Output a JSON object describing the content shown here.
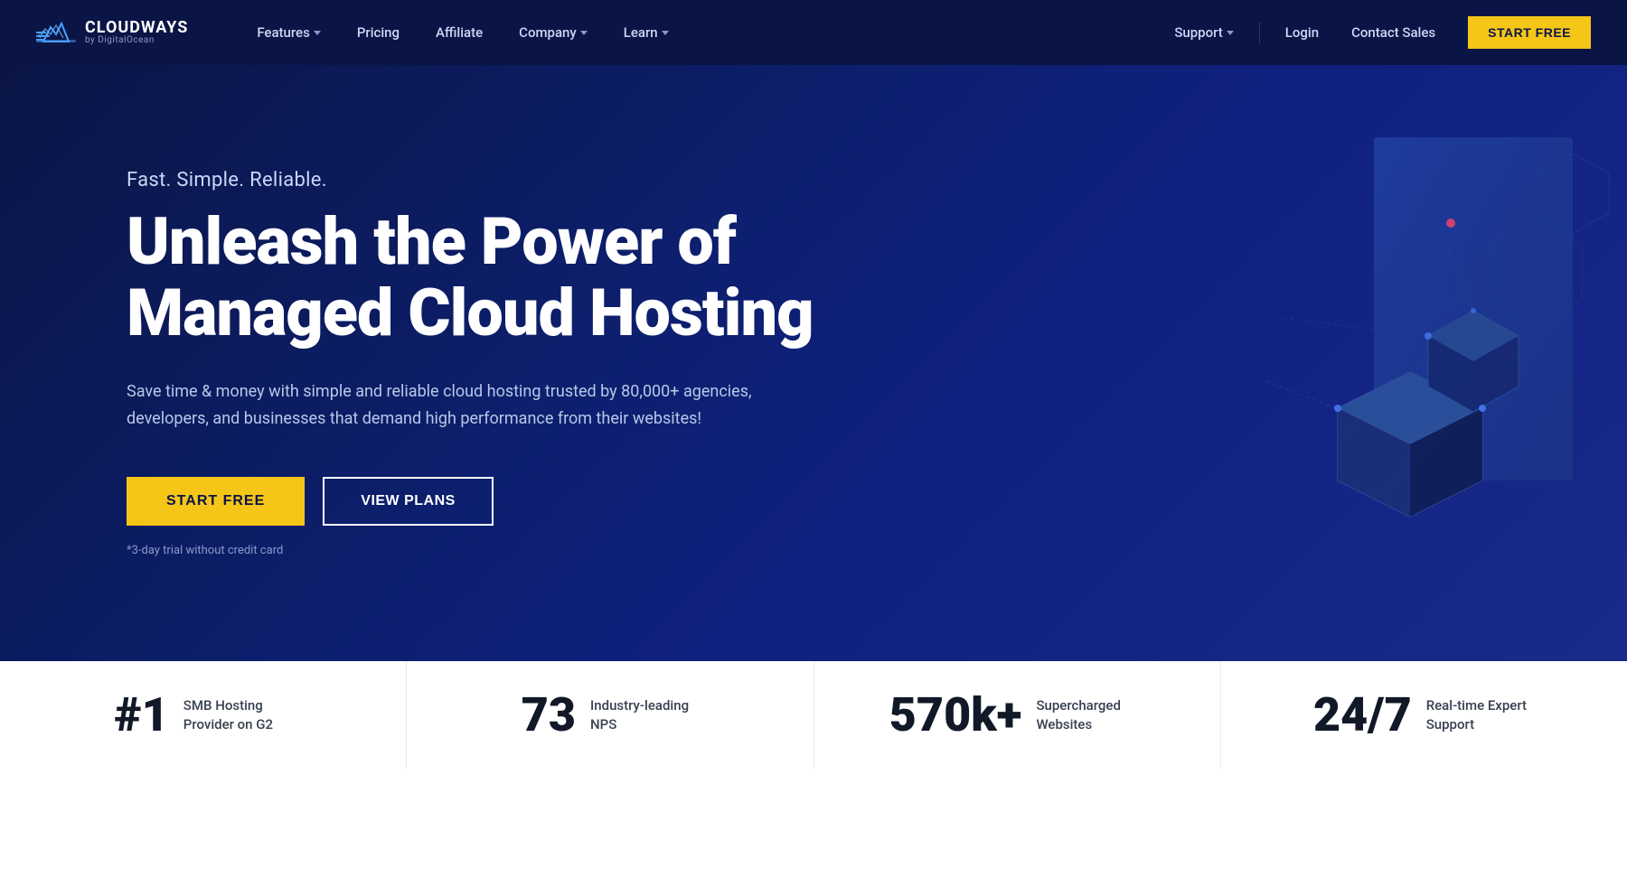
{
  "brand": {
    "name": "CLOUDWAYS",
    "sub": "by DigitalOcean",
    "logo_aria": "Cloudways logo"
  },
  "nav": {
    "links": [
      {
        "label": "Features",
        "has_dropdown": true
      },
      {
        "label": "Pricing",
        "has_dropdown": false
      },
      {
        "label": "Affiliate",
        "has_dropdown": false
      },
      {
        "label": "Company",
        "has_dropdown": true
      },
      {
        "label": "Learn",
        "has_dropdown": true
      }
    ],
    "right_links": [
      {
        "label": "Support",
        "has_dropdown": true
      },
      {
        "label": "Login",
        "has_dropdown": false
      },
      {
        "label": "Contact Sales",
        "has_dropdown": false
      }
    ],
    "cta_label": "START FREE"
  },
  "hero": {
    "tagline": "Fast. Simple. Reliable.",
    "title_line1": "Unleash the Power of",
    "title_line2": "Managed Cloud Hosting",
    "description": "Save time & money with simple and reliable cloud hosting trusted by 80,000+ agencies, developers, and businesses that demand high performance from their websites!",
    "cta_primary": "START FREE",
    "cta_secondary": "VIEW PLANS",
    "note": "*3-day trial without credit card"
  },
  "stats": [
    {
      "number": "#1",
      "description": "SMB Hosting Provider on G2"
    },
    {
      "number": "73",
      "description": "Industry-leading NPS"
    },
    {
      "number": "570k+",
      "description": "Supercharged Websites"
    },
    {
      "number": "24/7",
      "description": "Real-time Expert Support"
    }
  ],
  "colors": {
    "nav_bg": "#0a1545",
    "hero_bg": "#0d1f6e",
    "cta_yellow": "#f5c518",
    "text_light": "#ccd6f6",
    "stats_bg": "#ffffff"
  }
}
